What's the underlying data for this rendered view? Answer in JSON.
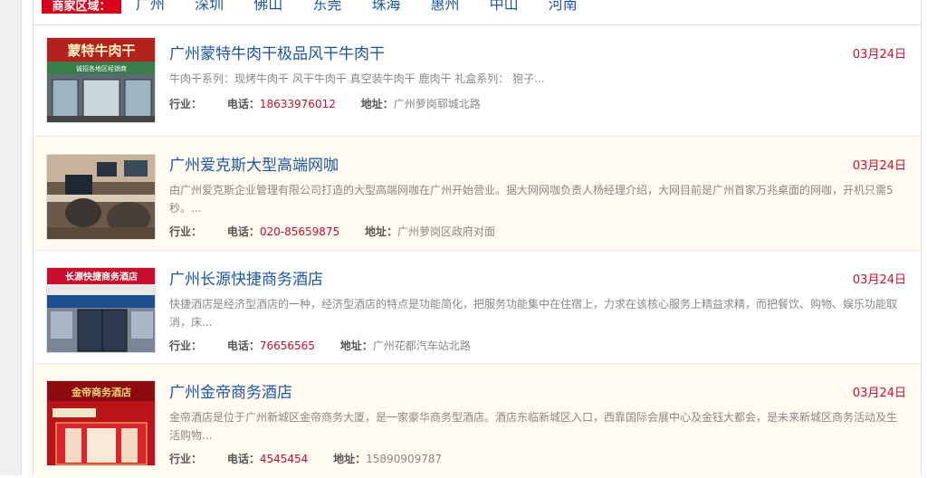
{
  "region": {
    "label": "商家区域：",
    "cities": [
      "广州",
      "深圳",
      "佛山",
      "东莞",
      "珠海",
      "惠州",
      "中山",
      "河南"
    ]
  },
  "labels": {
    "industry": "行业：",
    "phone": "电话：",
    "address": "地址："
  },
  "listings": [
    {
      "title": "广州蒙特牛肉干极品风干牛肉干",
      "date": "03月24日",
      "description": "牛肉干系列：现烤牛肉干 风干牛肉干 真空装牛肉干 鹿肉干 礼盒系列： 狍子...",
      "industry": "",
      "phone": "18633976012",
      "address": "广州萝岗郓城北路",
      "thumb_sign": "蒙特牛肉干",
      "thumb_sub": "诚招各地区经销商"
    },
    {
      "title": "广州爱克斯大型高端网咖",
      "date": "03月24日",
      "description": "由广州爱克斯企业管理有限公司打造的大型高端网咖在广州开始营业。据大网网咖负责人杨经理介绍，大网目前是广州首家万兆桌面的网咖，开机只需5秒。...",
      "industry": "",
      "phone": "020-85659875",
      "address": "广州萝岗区政府对面"
    },
    {
      "title": "广州长源快捷商务酒店",
      "date": "03月24日",
      "description": "快捷酒店是经济型酒店的一种，经济型酒店的特点是功能简化，把服务功能集中在住宿上，力求在该核心服务上精益求精，而把餐饮、购物、娱乐功能取消，床...",
      "industry": "",
      "phone": "76656565",
      "address": "广州花都汽车站北路",
      "thumb_sign": "长源快捷商务酒店"
    },
    {
      "title": "广州金帝商务酒店",
      "date": "03月24日",
      "description": "金帝酒店是位于广州新城区金帝商务大厦，是一家豪华商务型酒店。酒店东临新城区入口，西靠国际会展中心及金钰大都会，是未来新城区商务活动及生活购物...",
      "industry": "",
      "phone": "4545454",
      "address": "15890909787",
      "thumb_sign": "金帝商务酒店"
    }
  ],
  "colors": {
    "accent_red": "#d9001b",
    "link_blue": "#1d56a8",
    "alt_row": "#fffbf0"
  }
}
